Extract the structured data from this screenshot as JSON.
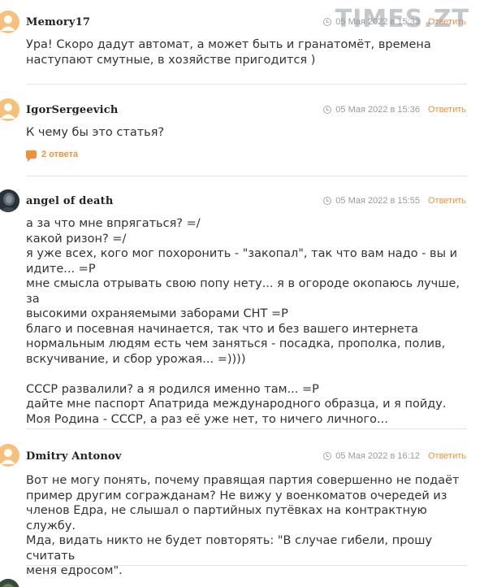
{
  "colors": {
    "accent": "#f0913a",
    "avatar_default": "#f6c07a",
    "meta_text": "#9a9a9a"
  },
  "watermark": "TIMES.ZT",
  "comments": [
    {
      "author": "Memory17",
      "date": "05 Мая 2022 в 15:33",
      "reply_label": "Ответить",
      "avatar": "default-user-icon",
      "text": "Ура! Скоро дадут автомат, а может быть и гранатомёт, времена\nнаступают смутные, в хозяйстве пригодится )"
    },
    {
      "author": "IgorSergeevich",
      "date": "05 Мая 2022 в 15:36",
      "reply_label": "Ответить",
      "avatar": "default-user-icon",
      "text": "К чему бы это статья?",
      "replies_label": "2 ответа"
    },
    {
      "author": "angel of death",
      "date": "05 Мая 2022 в 15:55",
      "reply_label": "Ответить",
      "avatar": "user-photo",
      "text": "а за что мне впрягаться? =/\nкакой ризон? =/\nя уже всех, кого мог похоронить - \"закопал\", так что вам надо - вы и\nидите... =Р\nмне смысла отрывать свою попу нету... я в огороде окопаюсь лучше, за\nвысокими охраняемыми заборами СНТ =Р\nблаго и посевная начинается, так что и без вашего интернета\nнормальным людям есть чем заняться - посадка, прополка, полив,\nвскучивание, и сбор урожая... =))))\n\nСССР развалили? а я родился именно там... =Р\nдайте мне паспорт Апатрида международного образца, и я пойду.\nМоя Родина - СССР, а раз её уже нет, то ничего личного..."
    },
    {
      "author": "Dmitry Antonov",
      "date": "05 Мая 2022 в 16:12",
      "reply_label": "Ответить",
      "avatar": "default-user-icon",
      "text": "Вот не могу понять, почему правящая партия совершенно не подаёт\nпример другим согражданам? Не вижу у военкоматов очередей из\nчленов Едра, не слышал о партийных путёвках на контрактную службу.\nМда, видать никто не будет повторять: \"В случае гибели, прошу считать\nменя едросом\"."
    }
  ]
}
